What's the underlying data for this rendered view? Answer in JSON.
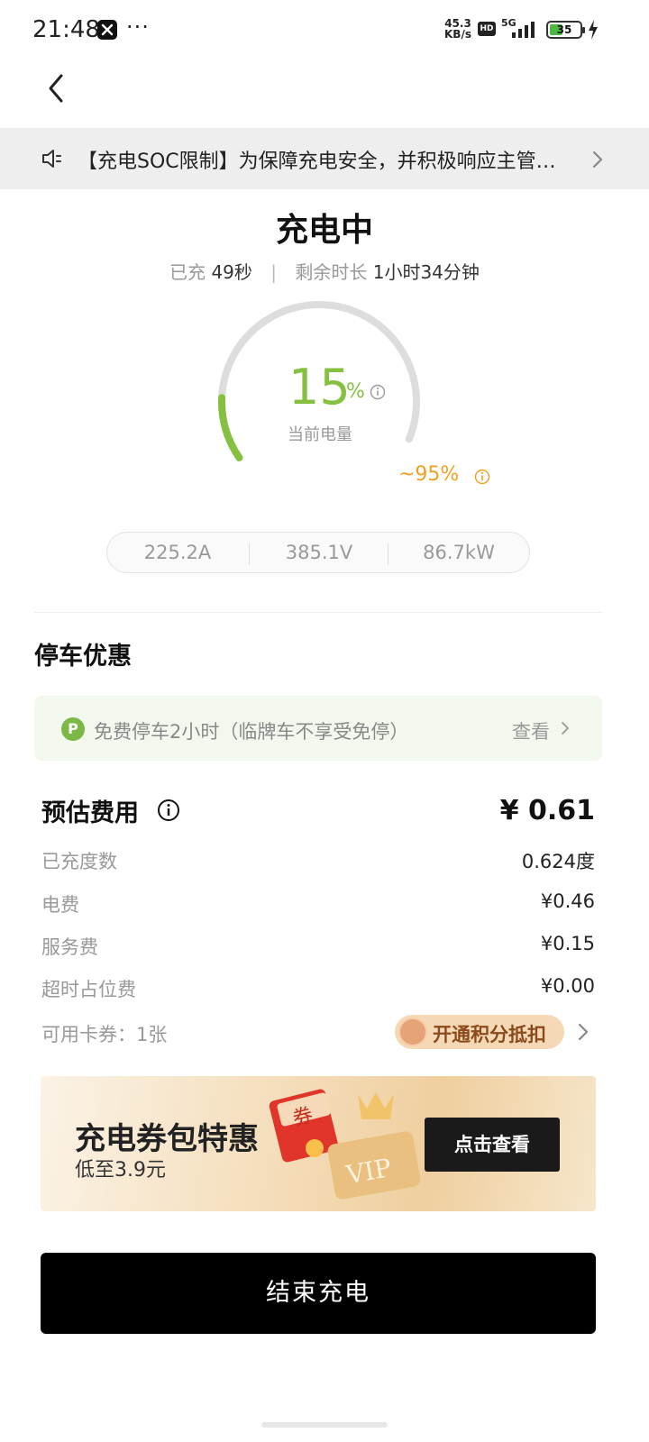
{
  "status_bar": {
    "time": "21:48",
    "more": "···",
    "net_speed_value": "45.3",
    "net_speed_unit": "KB/s",
    "hd": "HD",
    "network": "5G",
    "battery": "35"
  },
  "notice": {
    "text": "【充电SOC限制】为保障充电安全，并积极响应主管…"
  },
  "charging": {
    "title": "充电中",
    "charged_label": "已充",
    "charged_value": "49秒",
    "remaining_label": "剩余时长",
    "remaining_value": "1小时34分钟",
    "soc_value": "15",
    "soc_unit": "%",
    "soc_label": "当前电量",
    "soc_fraction": 0.15,
    "target": "~95%",
    "target_fraction": 0.95
  },
  "stats": {
    "current": "225.2A",
    "voltage": "385.1V",
    "power": "86.7kW"
  },
  "parking": {
    "section_title": "停车优惠",
    "badge": "P",
    "text": "免费停车2小时（临牌车不享受免停）",
    "view_label": "查看"
  },
  "fees": {
    "title": "预估费用",
    "total": "¥ 0.61",
    "rows": [
      {
        "label": "已充度数",
        "value": "0.624度"
      },
      {
        "label": "电费",
        "value": "¥0.46"
      },
      {
        "label": "服务费",
        "value": "¥0.15"
      },
      {
        "label": "超时占位费",
        "value": "¥0.00"
      }
    ],
    "coupons_label": "可用卡券：1张",
    "points_label": "开通积分抵扣"
  },
  "banner": {
    "title": "充电券包特惠",
    "subtitle": "低至3.9元",
    "coupon_char": "券",
    "vip_text": "VIP",
    "button": "点击查看"
  },
  "end_button": "结束充电",
  "colors": {
    "accent_green": "#86c040",
    "target_orange": "#f0a020",
    "gauge_track": "#dddddd"
  }
}
